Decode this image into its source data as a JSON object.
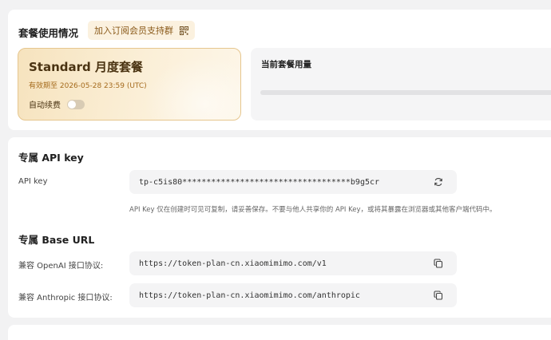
{
  "usage_section": {
    "title": "套餐使用情况",
    "join_group_label": "加入订阅会员支持群",
    "plan": {
      "name": "Standard 月度套餐",
      "expiry": "有效期至 2026-05-28 23:59 (UTC)",
      "auto_renew_label": "自动续费",
      "auto_renew_on": false
    },
    "current_usage_label": "当前套餐用量",
    "usage_progress_percent": 0
  },
  "api_key_section": {
    "title": "专属 API key",
    "label": "API key",
    "value": "tp-c5is80***********************************b9g5cr",
    "hint": "API Key 仅在创建时可见可复制，请妥善保存。不要与他人共享你的 API Key，或将其暴露在浏览器或其他客户端代码中。"
  },
  "base_url_section": {
    "title": "专属 Base URL",
    "openai_label": "兼容 OpenAI 接口协议:",
    "openai_url": "https://token-plan-cn.xiaomimimo.com/v1",
    "anthropic_label": "兼容 Anthropic 接口协议:",
    "anthropic_url": "https://token-plan-cn.xiaomimimo.com/anthropic"
  },
  "colors": {
    "accent": "#e0a446",
    "plan_text": "#4a3312",
    "expiry_text": "#a56b1d"
  }
}
